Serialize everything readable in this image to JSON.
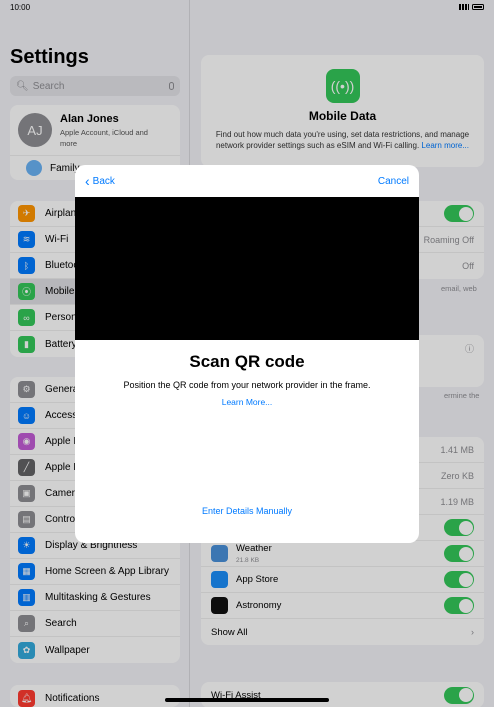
{
  "status": {
    "time": "10:00"
  },
  "sidebar": {
    "title": "Settings",
    "search_placeholder": "Search",
    "account": {
      "initials": "AJ",
      "name": "Alan Jones",
      "subtitle": "Apple Account, iCloud and more",
      "family": "Family"
    },
    "group1": [
      {
        "label": "Airplane Mode",
        "icon": "airplane-icon",
        "color": "#ff9500"
      },
      {
        "label": "Wi-Fi",
        "icon": "wifi-icon",
        "color": "#007aff"
      },
      {
        "label": "Bluetooth",
        "icon": "bluetooth-icon",
        "color": "#007aff"
      },
      {
        "label": "Mobile Data",
        "icon": "antenna-icon",
        "color": "#34c759"
      },
      {
        "label": "Personal Hotspot",
        "icon": "hotspot-icon",
        "color": "#34c759"
      },
      {
        "label": "Battery",
        "icon": "battery-icon",
        "color": "#34c759"
      }
    ],
    "group2": [
      {
        "label": "General",
        "icon": "gear-icon",
        "color": "#8e8e93"
      },
      {
        "label": "Accessibility",
        "icon": "accessibility-icon",
        "color": "#007aff"
      },
      {
        "label": "Apple Intelligence & Siri",
        "icon": "siri-icon",
        "color": "#c35cd6"
      },
      {
        "label": "Apple Pencil",
        "icon": "pencil-icon",
        "color": "#636366"
      },
      {
        "label": "Camera",
        "icon": "camera-icon",
        "color": "#8e8e93"
      },
      {
        "label": "Control Centre",
        "icon": "control-centre-icon",
        "color": "#8e8e93"
      },
      {
        "label": "Display & Brightness",
        "icon": "sun-icon",
        "color": "#007aff"
      },
      {
        "label": "Home Screen & App Library",
        "icon": "home-screen-icon",
        "color": "#007aff"
      },
      {
        "label": "Multitasking & Gestures",
        "icon": "multitasking-icon",
        "color": "#007aff"
      },
      {
        "label": "Search",
        "icon": "search-icon",
        "color": "#8e8e93"
      },
      {
        "label": "Wallpaper",
        "icon": "wallpaper-icon",
        "color": "#34aadc"
      }
    ],
    "group3": [
      {
        "label": "Notifications",
        "icon": "bell-icon",
        "color": "#ff3b30"
      }
    ]
  },
  "detail": {
    "hero_title": "Mobile Data",
    "hero_desc": "Find out how much data you're using, set data restrictions, and manage network provider settings such as eSIM and Wi-Fi calling.",
    "hero_learn": "Learn more...",
    "rows_a_values": [
      "",
      "Roaming Off",
      "Off"
    ],
    "foot_a": "email, web",
    "foot_b": "ermine the",
    "usage_values": [
      "1.41 MB",
      "Zero KB",
      "1.19 MB"
    ],
    "apps": [
      {
        "name": "Weather",
        "size": "21.8 KB",
        "color": "#4a90d9"
      },
      {
        "name": "App Store",
        "size": "",
        "color": "#1c8ef9"
      },
      {
        "name": "Astronomy",
        "size": "",
        "color": "#111111"
      }
    ],
    "show_all": "Show All",
    "wifi_assist": "Wi-Fi Assist"
  },
  "modal": {
    "back": "Back",
    "cancel": "Cancel",
    "title": "Scan QR code",
    "description": "Position the QR code from your network provider in the frame.",
    "learn_more": "Learn More...",
    "manual": "Enter Details Manually"
  }
}
